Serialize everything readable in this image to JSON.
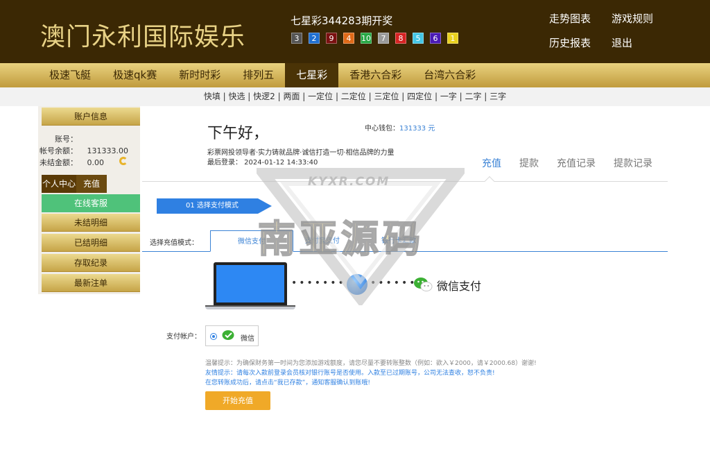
{
  "header": {
    "logo": "澳门永利国际娱乐",
    "draw_title": "七星彩344283期开奖",
    "balls": [
      {
        "num": "3",
        "color": "#555555"
      },
      {
        "num": "2",
        "color": "#1f6fd1"
      },
      {
        "num": "9",
        "color": "#7a1010"
      },
      {
        "num": "4",
        "color": "#e06a18"
      },
      {
        "num": "10",
        "color": "#27a845"
      },
      {
        "num": "7",
        "color": "#9a9a9a"
      },
      {
        "num": "8",
        "color": "#d62222"
      },
      {
        "num": "5",
        "color": "#45c6e6"
      },
      {
        "num": "6",
        "color": "#4a1ab5"
      },
      {
        "num": "1",
        "color": "#e8d01e"
      }
    ],
    "links": [
      "走势图表",
      "游戏规则",
      "历史报表",
      "退出"
    ]
  },
  "nav": {
    "tabs": [
      "极速飞艇",
      "极速qk赛",
      "新时时彩",
      "排列五",
      "七星彩",
      "香港六合彩",
      "台湾六合彩"
    ],
    "active_index": 4
  },
  "subnav": "快填 | 快选 | 快逻2 | 两面 | 一定位 | 二定位 | 三定位 | 四定位 | 一字 | 二字 | 三字",
  "sidebar": {
    "account_info": "账户信息",
    "account_label": "账号：",
    "account_value": "",
    "balance_label": "帐号余额：",
    "balance_value": "131333.00",
    "unsettled_label": "未结金额：",
    "unsettled_value": "0.00",
    "personal_center": "个人中心",
    "recharge": "充值",
    "online_service": "在线客服",
    "items": [
      "未结明细",
      "已结明细",
      "存取纪录",
      "最新注单"
    ]
  },
  "main": {
    "greeting": "下午好，",
    "wallet_label": "中心钱包：",
    "wallet_value": "131333 元",
    "slogan": "彩票网投领导者·实力铸就品牌·诚信打造一切·相信品牌的力量",
    "last_login": "最后登录：  2024-01-12 14:33:40",
    "right_tabs": [
      "充值",
      "提款",
      "充值记录",
      "提款记录"
    ],
    "step": "01 选择支付模式",
    "mode_label": "选择充值模式：",
    "mode_tabs": [
      "微信支付",
      "支付宝支付",
      "银行卡汇款"
    ],
    "wechat_pay": "微信支付",
    "pay_account_label": "支付帐户：",
    "pay_account_option": "微信",
    "tips": [
      "温馨提示：为确保财务第一时间为您添加游戏额度，请您尽量不要转账整数（例如：欲入￥2000，请￥2000.68）谢谢!",
      "友情提示：请每次入款前登录会员核对银行账号是否使用。入款至已过期账号，公司无法查收，恕不负责!",
      "在您转账成功后，请点击“我已存款”，通知客服确认到账哦!"
    ],
    "start_button": "开始充值"
  },
  "watermark": {
    "text": "南亚源码",
    "url": "KYXR.COM"
  }
}
